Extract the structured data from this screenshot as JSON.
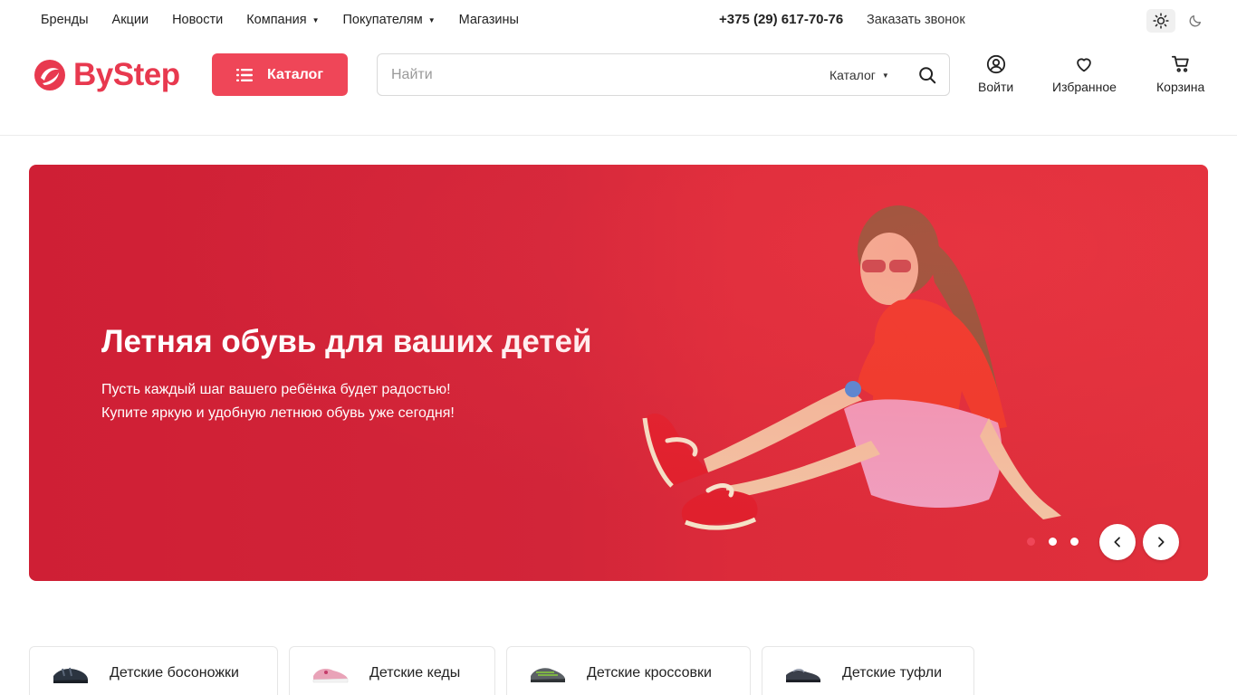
{
  "top_nav": {
    "items": [
      {
        "label": "Бренды",
        "dropdown": false
      },
      {
        "label": "Акции",
        "dropdown": false
      },
      {
        "label": "Новости",
        "dropdown": false
      },
      {
        "label": "Компания",
        "dropdown": true
      },
      {
        "label": "Покупателям",
        "dropdown": true
      },
      {
        "label": "Магазины",
        "dropdown": false
      }
    ],
    "phone": "+375 (29) 617-70-76",
    "callback_label": "Заказать звонок",
    "theme": {
      "light_icon": "sun-icon",
      "dark_icon": "moon-icon",
      "active": "light"
    }
  },
  "header": {
    "logo_text": "ByStep",
    "catalog_button": "Каталог",
    "search": {
      "placeholder": "Найти",
      "value": "",
      "category_label": "Каталог"
    },
    "actions": {
      "login": "Войти",
      "favorites": "Избранное",
      "cart": "Корзина"
    }
  },
  "banner": {
    "title": "Летняя обувь для ваших детей",
    "line1": "Пусть каждый шаг вашего ребёнка будет радостью!",
    "line2": "Купите яркую и удобную летнюю обувь уже сегодня!",
    "slides_total": 3,
    "active_slide": 1
  },
  "categories": [
    {
      "label": "Детские босоножки",
      "icon": "sandal-icon"
    },
    {
      "label": "Детские кеды",
      "icon": "sneaker-pink-icon"
    },
    {
      "label": "Детские кроссовки",
      "icon": "running-shoe-icon"
    },
    {
      "label": "Детские туфли",
      "icon": "shoe-icon"
    }
  ],
  "colors": {
    "accent": "#ef4658",
    "banner_bg": "#d22539",
    "logo": "#e8394f"
  }
}
